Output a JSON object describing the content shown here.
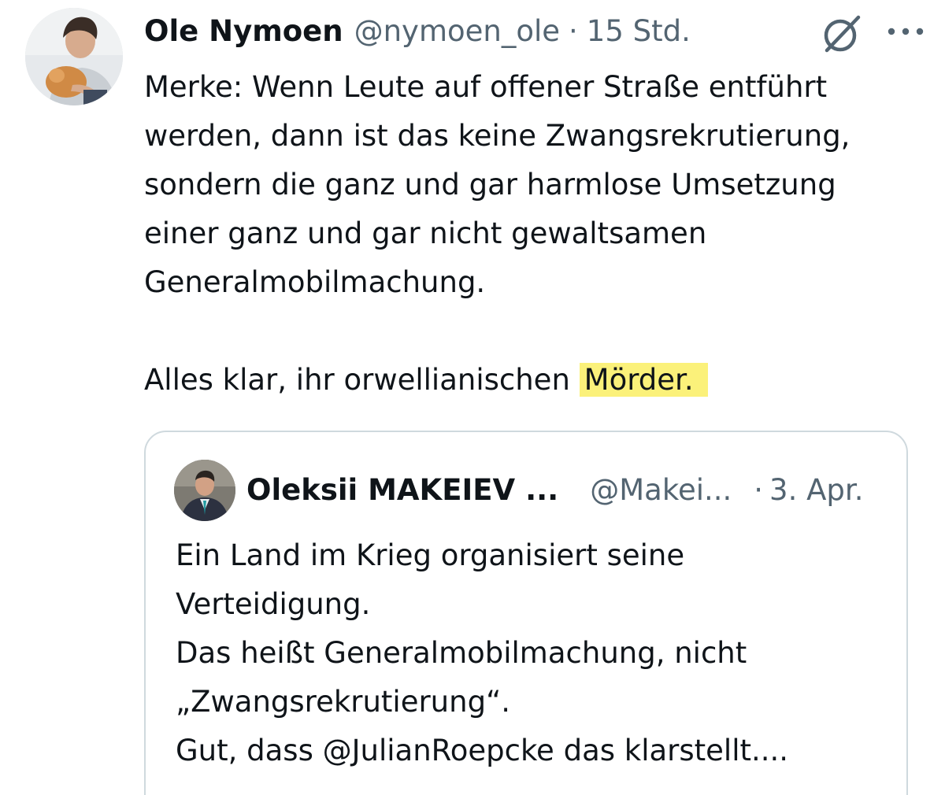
{
  "tweet": {
    "author_name": "Ole Nymoen",
    "author_handle": "@nymoen_ole",
    "separator": "·",
    "time": "15 Std.",
    "avatar_icon": "user-avatar",
    "grok_icon": "grok-icon",
    "more_icon": "more-options-icon",
    "text_lines": [
      "Merke: Wenn Leute auf offener Straße entführt",
      "werden, dann ist das keine Zwangsrekrutierung,",
      "sondern die ganz und gar harmlose Umsetzung",
      "einer ganz und gar nicht gewaltsamen",
      "Generalmobilmachung."
    ],
    "closing_prefix": "Alles klar, ihr orwellianischen",
    "closing_highlight": "Mörder.",
    "highlight_color": "#fbf17a"
  },
  "quote": {
    "author_name": "Oleksii MAKEIEV ...",
    "author_handle": "@Makei...",
    "separator": "·",
    "time": "3. Apr.",
    "avatar_icon": "user-avatar",
    "text_lines": [
      "Ein Land im Krieg organisiert seine",
      "Verteidigung.",
      "Das heißt Generalmobilmachung, nicht",
      "„Zwangsrekrutierung“.",
      "Gut, dass @JulianRoepcke das klarstellt...."
    ]
  },
  "colors": {
    "text": "#0f1419",
    "secondary": "#536471",
    "border": "#cfd9de"
  }
}
